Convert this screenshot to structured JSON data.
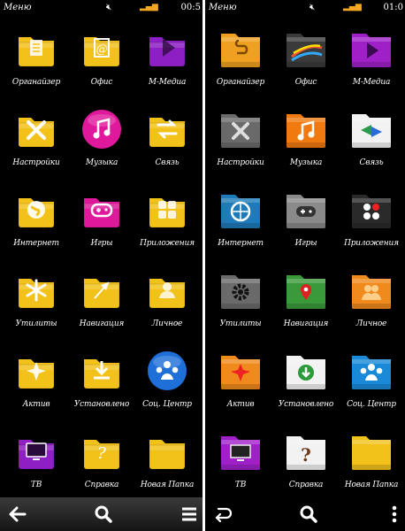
{
  "left": {
    "status": {
      "title": "Меню",
      "mute_icon": "speaker-mute-icon",
      "time": "00:5"
    },
    "items": [
      {
        "label": "Органайзер",
        "icon": "organizer-icon"
      },
      {
        "label": "Офис",
        "icon": "office-icon"
      },
      {
        "label": "М-Медиа",
        "icon": "media-icon"
      },
      {
        "label": "Настройки",
        "icon": "settings-icon"
      },
      {
        "label": "Музыка",
        "icon": "music-icon"
      },
      {
        "label": "Связь",
        "icon": "connectivity-icon"
      },
      {
        "label": "Интернет",
        "icon": "internet-icon"
      },
      {
        "label": "Игры",
        "icon": "games-icon"
      },
      {
        "label": "Приложения",
        "icon": "applications-icon"
      },
      {
        "label": "Утилиты",
        "icon": "utilities-icon"
      },
      {
        "label": "Навигация",
        "icon": "navigation-icon"
      },
      {
        "label": "Личное",
        "icon": "personal-icon"
      },
      {
        "label": "Актив",
        "icon": "active-icon"
      },
      {
        "label": "Установлено",
        "icon": "installed-icon"
      },
      {
        "label": "Соц. Центр",
        "icon": "social-center-icon"
      },
      {
        "label": "ТВ",
        "icon": "tv-icon"
      },
      {
        "label": "Справка",
        "icon": "help-icon"
      },
      {
        "label": "Новая Папка",
        "icon": "new-folder-icon"
      }
    ],
    "toolbar": [
      "back-arrow-icon",
      "search-icon",
      "menu-icon"
    ]
  },
  "right": {
    "status": {
      "title": "Меню",
      "mute_icon": "speaker-mute-icon",
      "time": "01:0"
    },
    "items": [
      {
        "label": "Органайзер",
        "icon": "organizer-icon"
      },
      {
        "label": "Офис",
        "icon": "office-icon"
      },
      {
        "label": "М-Медиа",
        "icon": "media-icon"
      },
      {
        "label": "Настройки",
        "icon": "settings-icon"
      },
      {
        "label": "Музыка",
        "icon": "music-icon"
      },
      {
        "label": "Связь",
        "icon": "connectivity-icon"
      },
      {
        "label": "Интернет",
        "icon": "internet-icon"
      },
      {
        "label": "Игры",
        "icon": "games-icon"
      },
      {
        "label": "Приложения",
        "icon": "applications-icon"
      },
      {
        "label": "Утилиты",
        "icon": "utilities-icon"
      },
      {
        "label": "Навигация",
        "icon": "navigation-icon"
      },
      {
        "label": "Личное",
        "icon": "personal-icon"
      },
      {
        "label": "Актив",
        "icon": "active-icon"
      },
      {
        "label": "Установлено",
        "icon": "installed-icon"
      },
      {
        "label": "Соц. Центр",
        "icon": "social-center-icon"
      },
      {
        "label": "ТВ",
        "icon": "tv-icon"
      },
      {
        "label": "Справка",
        "icon": "help-icon"
      },
      {
        "label": "Новая Папка",
        "icon": "new-folder-icon"
      }
    ],
    "toolbar": [
      "undo-arrow-icon",
      "search-icon",
      "options-dots-icon"
    ]
  },
  "colors": {
    "yellow": "#f2c21b",
    "magenta": "#e0199c",
    "purple": "#8e1fc4",
    "blue": "#1e6fd8",
    "orange": "#f08a1c",
    "gray": "#6b6b6b",
    "green": "#3a9a3a"
  }
}
